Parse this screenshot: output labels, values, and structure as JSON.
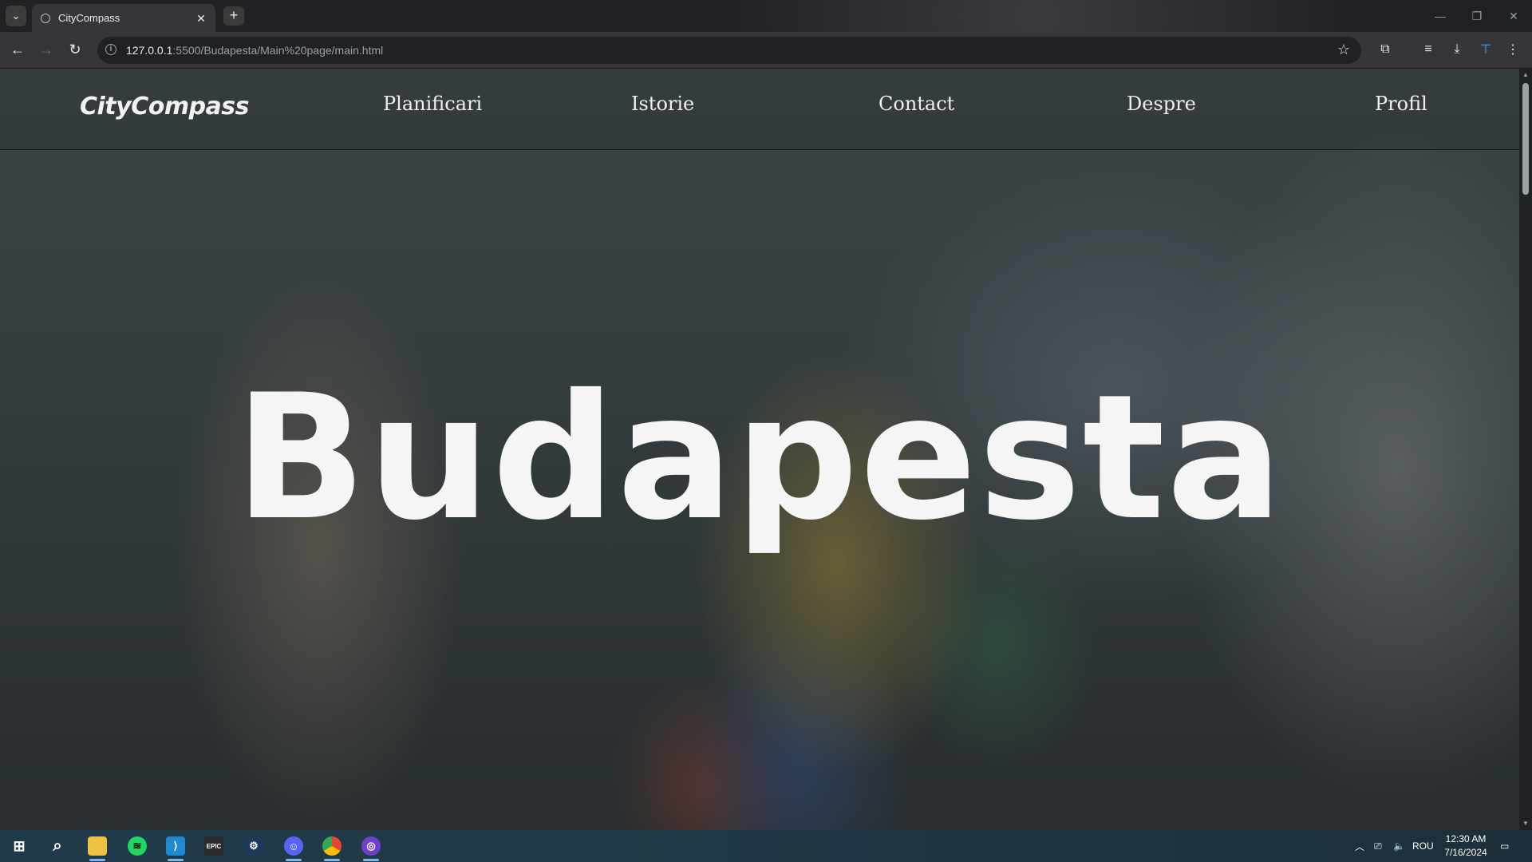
{
  "browser": {
    "tab_title": "CityCompass",
    "url_host": "127.0.0.1",
    "url_rest": ":5500/Budapesta/Main%20page/main.html"
  },
  "site": {
    "logo": "CityCompass",
    "nav": [
      "Planificari",
      "Istorie",
      "Contact",
      "Despre",
      "Profil"
    ],
    "hero_title": "Budapesta"
  },
  "taskbar": {
    "apps": [
      "windows-start",
      "search",
      "file-explorer",
      "spotify",
      "vscode",
      "epic-games",
      "steam",
      "discord",
      "chrome",
      "github-desktop"
    ],
    "language": "ROU",
    "time": "12:30 AM",
    "date": "7/16/2024"
  }
}
